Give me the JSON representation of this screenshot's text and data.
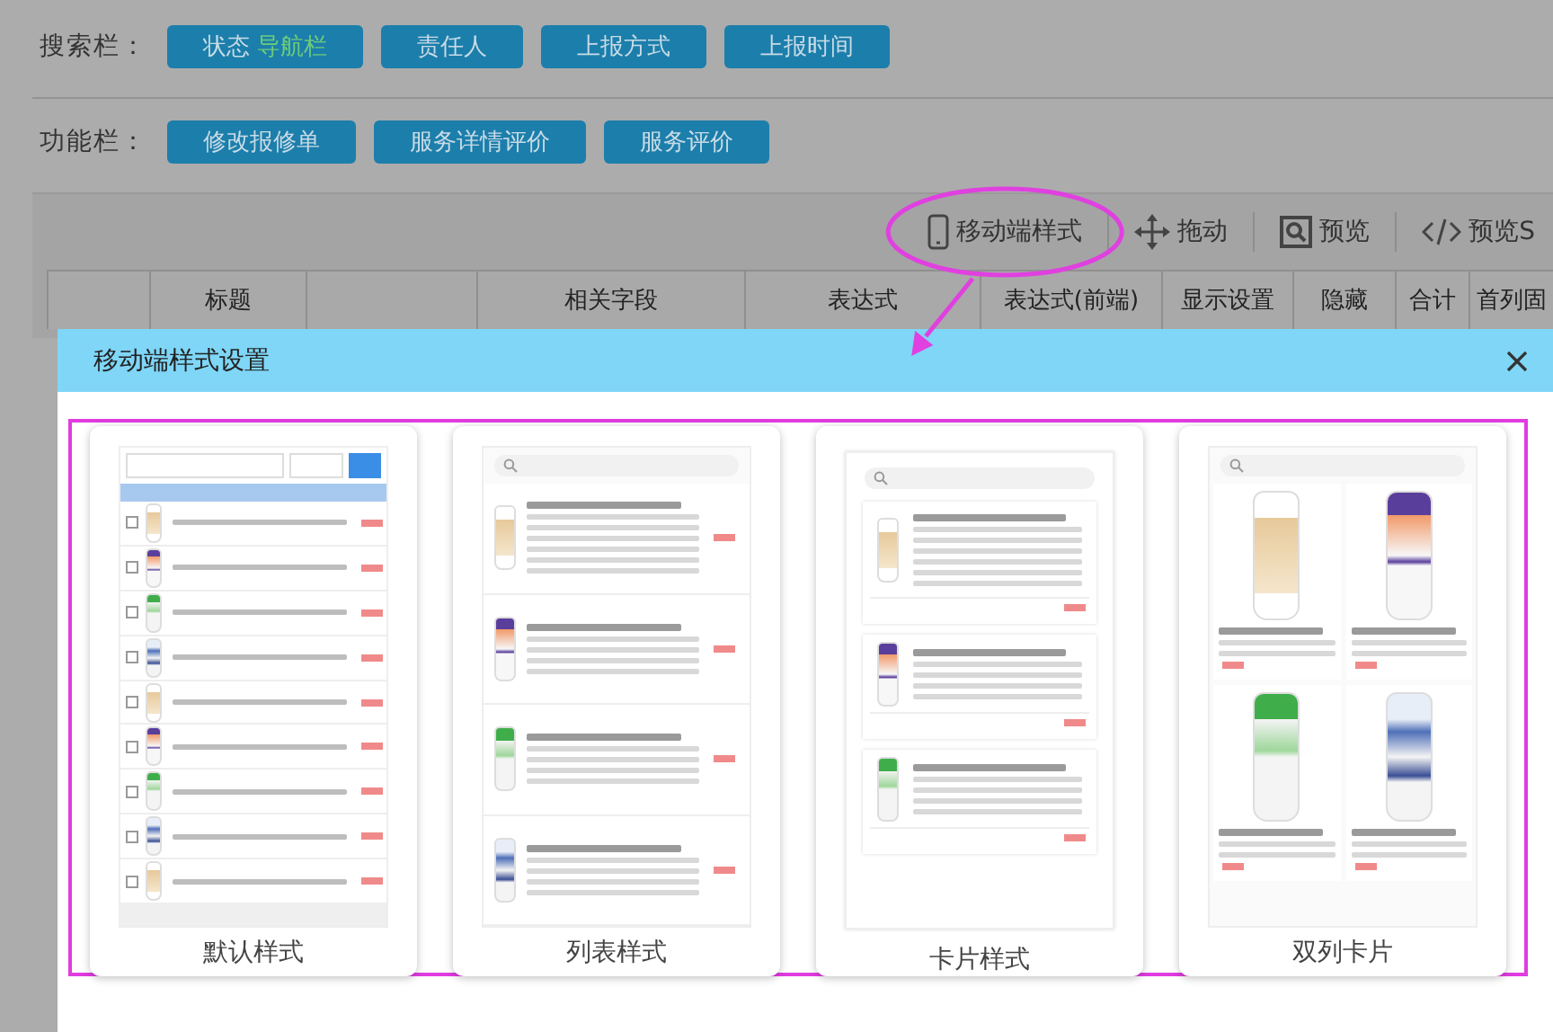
{
  "search_bar": {
    "label": "搜索栏：",
    "buttons": [
      {
        "text": "状态",
        "highlight": "导航栏"
      },
      {
        "text": "责任人"
      },
      {
        "text": "上报方式"
      },
      {
        "text": "上报时间"
      }
    ]
  },
  "function_bar": {
    "label": "功能栏：",
    "buttons": [
      "修改报修单",
      "服务详情评价",
      "服务评价"
    ]
  },
  "toolbar": {
    "items": [
      {
        "kind": "mobile",
        "label": "移动端样式",
        "highlighted": true
      },
      {
        "kind": "drag",
        "label": "拖动",
        "highlighted": false
      },
      {
        "kind": "preview",
        "label": "预览",
        "highlighted": false
      },
      {
        "kind": "code",
        "label": "预览S",
        "highlighted": false
      }
    ]
  },
  "table": {
    "columns": [
      {
        "kind": "blank"
      },
      {
        "kind": "text",
        "label": "标题"
      },
      {
        "kind": "blank"
      },
      {
        "kind": "text",
        "label": "相关字段"
      },
      {
        "kind": "text",
        "label": "表达式"
      },
      {
        "kind": "text",
        "label": "表达式(前端)"
      },
      {
        "kind": "text",
        "label": "显示设置"
      },
      {
        "kind": "text",
        "label": "隐藏"
      },
      {
        "kind": "text",
        "label": "合计"
      },
      {
        "kind": "text",
        "label": "首列固"
      }
    ]
  },
  "modal": {
    "title": "移动端样式设置",
    "styles": [
      {
        "kind": "default",
        "label": "默认样式"
      },
      {
        "kind": "list",
        "label": "列表样式"
      },
      {
        "kind": "card",
        "label": "卡片样式"
      },
      {
        "kind": "double",
        "label": "双列卡片"
      }
    ]
  }
}
